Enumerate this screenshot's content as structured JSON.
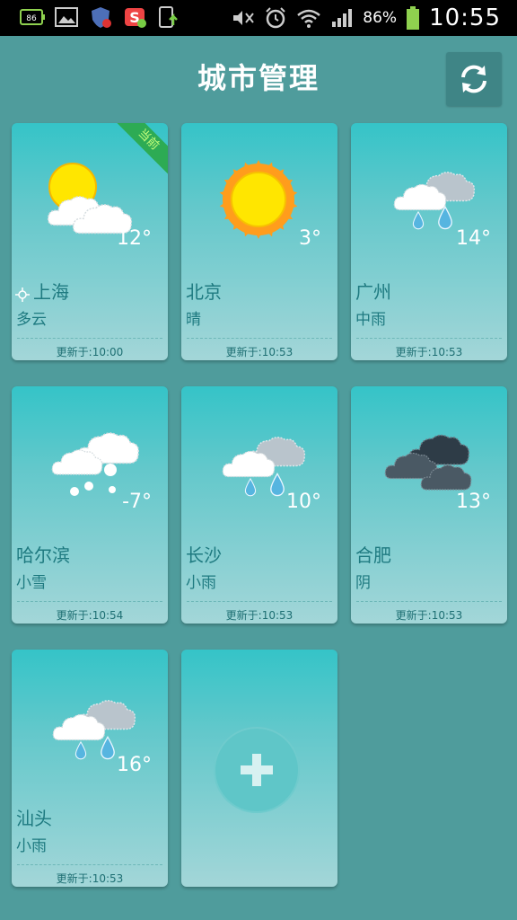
{
  "status_bar": {
    "battery_percent": "86%",
    "time": "10:55",
    "small_battery": "86"
  },
  "header": {
    "title": "城市管理",
    "refresh_icon": "refresh-icon"
  },
  "cities": [
    {
      "name": "上海",
      "condition": "多云",
      "temp": "12°",
      "updated": "更新于:10:00",
      "icon": "partly-cloudy-icon",
      "current": true,
      "badge": "当前"
    },
    {
      "name": "北京",
      "condition": "晴",
      "temp": "3°",
      "updated": "更新于:10:53",
      "icon": "sunny-icon"
    },
    {
      "name": "广州",
      "condition": "中雨",
      "temp": "14°",
      "updated": "更新于:10:53",
      "icon": "moderate-rain-icon"
    },
    {
      "name": "哈尔滨",
      "condition": "小雪",
      "temp": "-7°",
      "updated": "更新于:10:54",
      "icon": "light-snow-icon"
    },
    {
      "name": "长沙",
      "condition": "小雨",
      "temp": "10°",
      "updated": "更新于:10:53",
      "icon": "light-rain-icon"
    },
    {
      "name": "合肥",
      "condition": "阴",
      "temp": "13°",
      "updated": "更新于:10:53",
      "icon": "overcast-icon"
    },
    {
      "name": "汕头",
      "condition": "小雨",
      "temp": "16°",
      "updated": "更新于:10:53",
      "icon": "light-rain-icon"
    }
  ],
  "add_city": {
    "icon": "plus-icon"
  },
  "colors": {
    "background": "#4f9c9c",
    "card_top": "#35c4c8",
    "card_bottom": "#a3d6d8",
    "text": "#1e7a80",
    "badge": "#2dab54"
  }
}
